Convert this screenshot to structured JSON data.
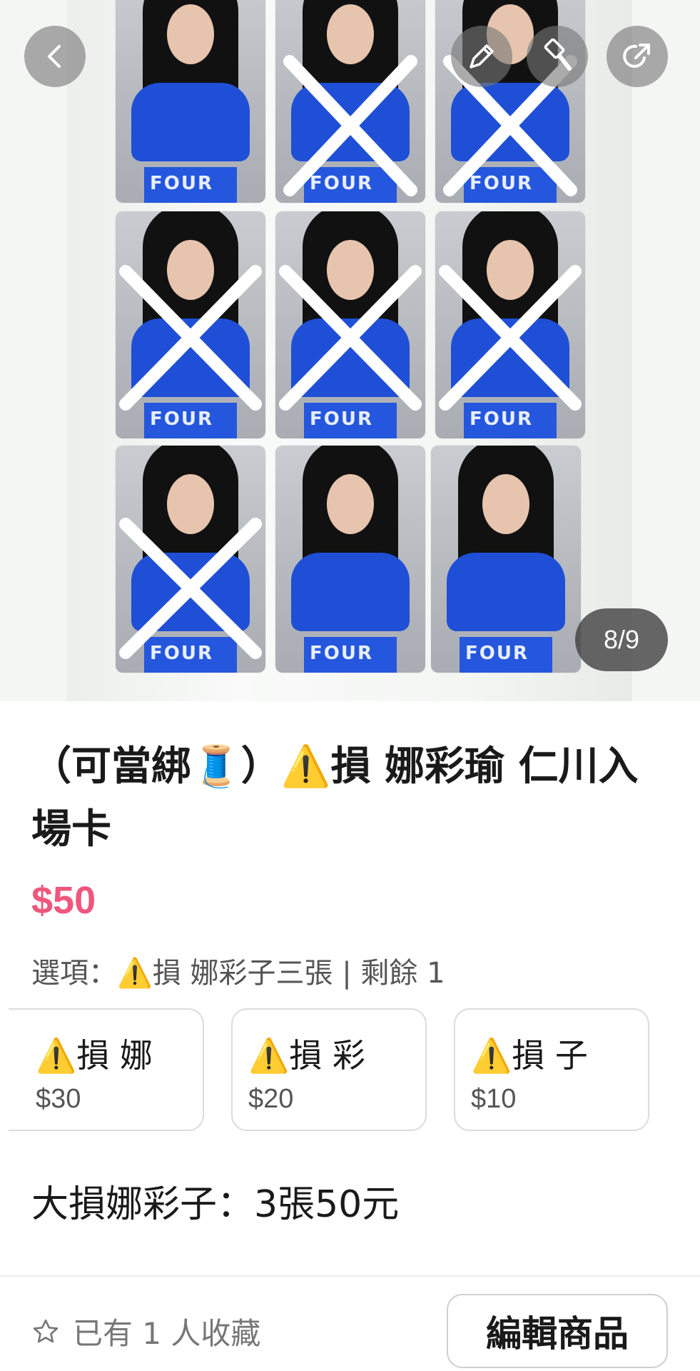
{
  "gallery": {
    "counter": "8/9",
    "card_skirt_text": "FOUR"
  },
  "product": {
    "title": "（可當綁🧵）⚠️損 娜彩瑜 仁川入場卡",
    "price": "$50",
    "options_line": "選項：⚠️損 娜彩子三張 | 剩餘 1",
    "options": [
      {
        "name": "⚠️損 娜",
        "price": "$30"
      },
      {
        "name": "⚠️損 彩",
        "price": "$20"
      },
      {
        "name": "⚠️損 子",
        "price": "$10"
      }
    ],
    "description": "大損娜彩子：3張50元"
  },
  "footer": {
    "favorites_text": "已有 1 人收藏",
    "edit_button": "編輯商品"
  },
  "colors": {
    "price": "#f0567d",
    "photo_top": "#1f4fd6"
  }
}
